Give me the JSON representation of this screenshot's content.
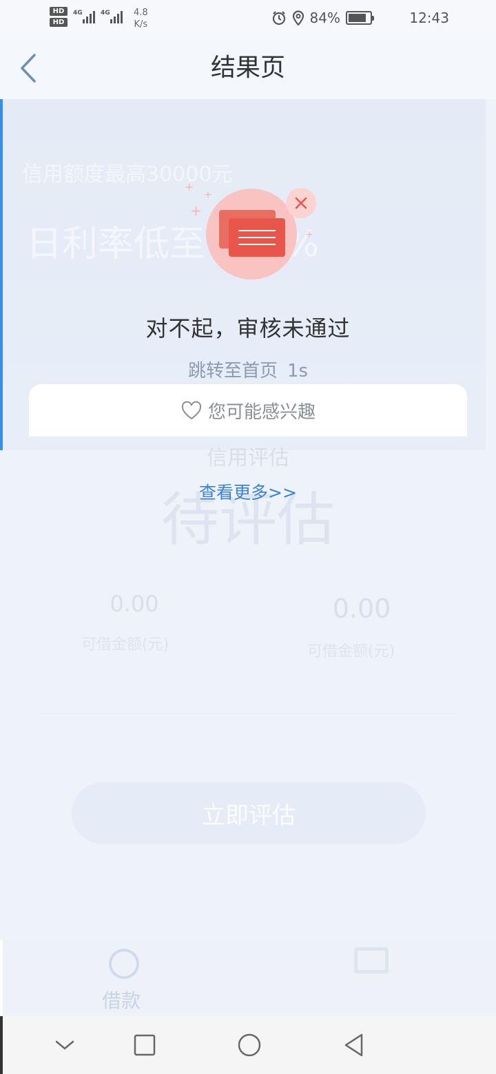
{
  "status_bar": {
    "hd1": "HD",
    "hd2": "HD",
    "net1": "4G",
    "net2": "4G",
    "speed_value": "4.8",
    "speed_unit": "K/s",
    "battery_percent": "84%",
    "battery_level": 0.84,
    "time": "12:43"
  },
  "header": {
    "title": "结果页"
  },
  "background_page": {
    "credit_quota": "信用额度最高30000元",
    "daily_rate": "日利率低至0.05%",
    "card_label": "信用评估",
    "pending_status": "待评估",
    "value_left": "0.00",
    "value_right": "0.00",
    "label_left": "可借金额(元)",
    "label_right": "可借金额(元)",
    "evaluate_button": "立即评估",
    "tab_loan": "借款"
  },
  "result": {
    "message": "对不起，审核未通过",
    "redirect_text": "跳转至首页",
    "countdown": "1s"
  },
  "interest": {
    "label": "您可能感兴趣",
    "more_link": "查看更多>>"
  },
  "colors": {
    "accent_blue": "#3b82d6",
    "fail_red": "#e8554a",
    "fail_pink": "#f8c3c0"
  },
  "icons": {
    "back": "chevron-left-icon",
    "alarm": "alarm-icon",
    "location": "location-icon",
    "heart": "heart-outline-icon",
    "card_fail": "card-rejected-icon"
  }
}
